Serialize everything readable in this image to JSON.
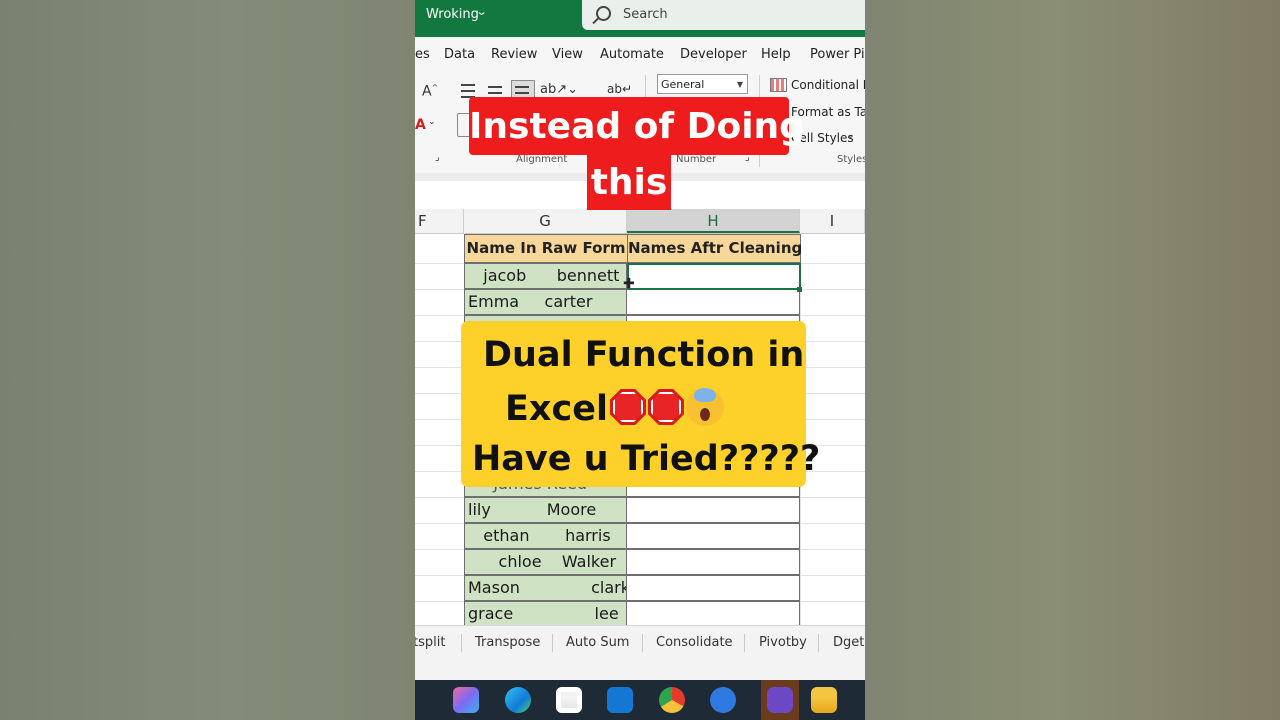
{
  "titlebar": {
    "workbook_name": "Wroking",
    "search_placeholder": "Search"
  },
  "menu": {
    "items": [
      "es",
      "Data",
      "Review",
      "View",
      "Automate",
      "Developer",
      "Help",
      "Power Piv"
    ]
  },
  "ribbon": {
    "number_format": "General",
    "conditional_formatting": "Conditional Fo",
    "format_as_table": "Format as Tab",
    "cell_styles": "Cell Styles",
    "groups": {
      "alignment": "Alignment",
      "number": "Number",
      "styles": "Styles"
    }
  },
  "grid": {
    "columns": [
      "F",
      "G",
      "H",
      "I"
    ],
    "header_g": "Name In Raw Form",
    "header_h": "Names Aftr Cleaning",
    "rows_top": [
      "   jacob      bennett",
      "Emma     carter"
    ],
    "row_partial": "     James Reed",
    "rows_bottom": [
      "lily           Moore",
      "   ethan       harris",
      "      chloe    Walker",
      "Mason              clark",
      "grace                lee"
    ]
  },
  "sheet_tabs": [
    "tsplit",
    "Transpose",
    "Auto Sum",
    "Consolidate",
    "Pivotby",
    "Dget"
  ],
  "overlay": {
    "top_line1": "Instead of Doing",
    "top_line2": "this",
    "card_line1": "Dual Function in",
    "card_line2": "Excel",
    "card_line3": "Have u Tried?????"
  },
  "colors": {
    "excel_green": "#137840",
    "banner_red": "#ee1c1c",
    "card_yellow": "#fdd02a",
    "raw_cell_green": "#cfe3c4",
    "header_cell_orange": "#f8d89a"
  }
}
